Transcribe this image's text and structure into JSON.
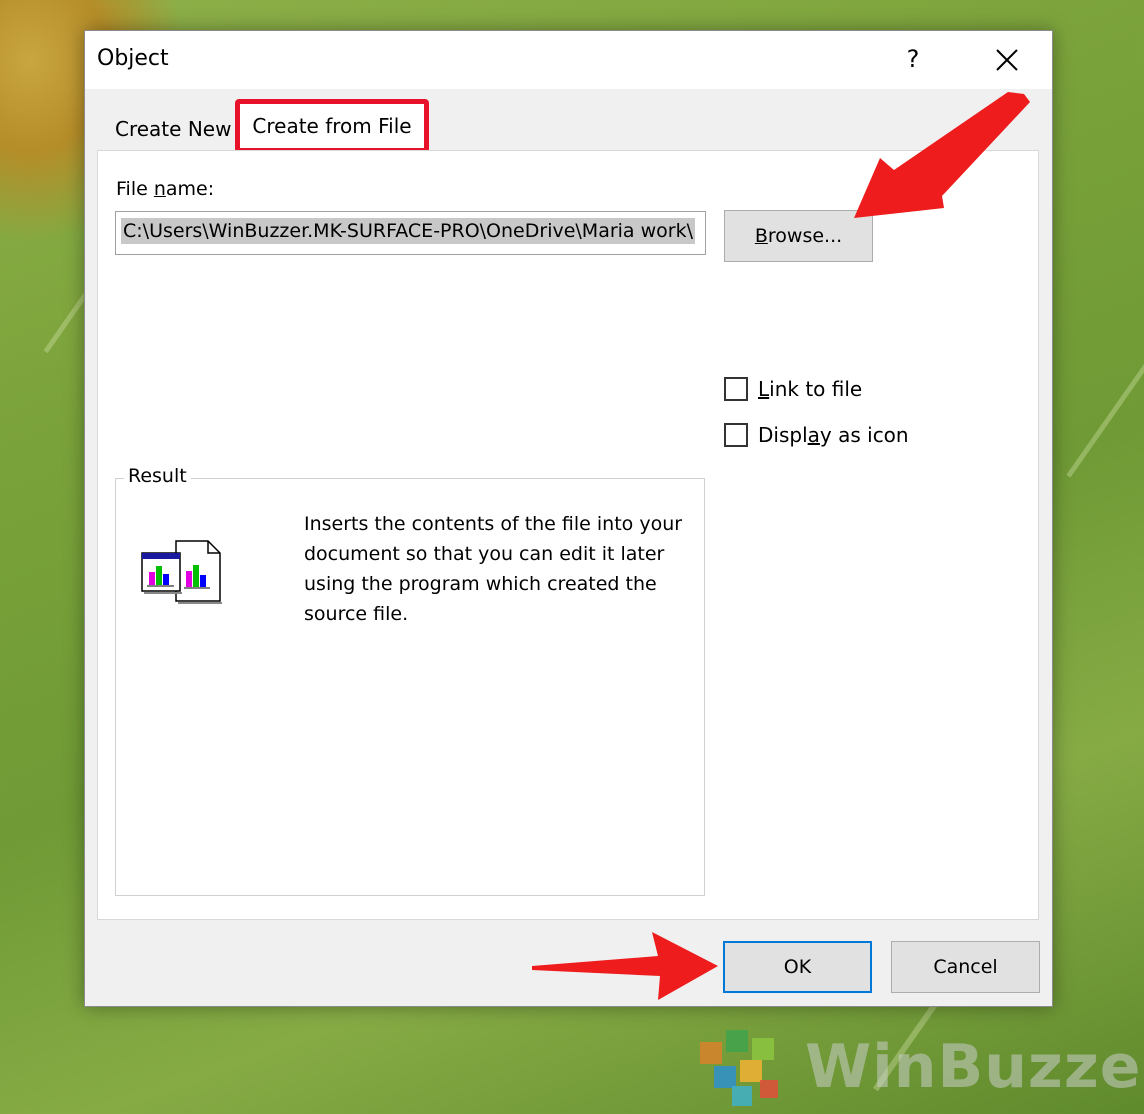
{
  "dialog": {
    "title": "Object",
    "help_glyph": "?",
    "close_icon": "close-icon"
  },
  "tabs": [
    {
      "label": "Create New",
      "selected": false
    },
    {
      "label": "Create from File",
      "selected": true,
      "highlight_color": "#e8132a"
    }
  ],
  "file": {
    "label_prefix": "File ",
    "label_mnemonic": "n",
    "label_suffix": "ame:",
    "value": "C:\\Users\\WinBuzzer.MK-SURFACE-PRO\\OneDrive\\Maria work\\"
  },
  "browse": {
    "mnemonic": "B",
    "rest": "rowse..."
  },
  "options": {
    "link_prefix": "",
    "link_mnemonic": "L",
    "link_suffix": "ink to file",
    "link_checked": false,
    "display_prefix": "Displ",
    "display_mnemonic": "a",
    "display_suffix": "y as icon",
    "display_checked": false
  },
  "result": {
    "title": "Result",
    "description": "Inserts the contents of the file into your document so that you can edit it later using the program which created the source file.",
    "icon": "embedded-document-icon"
  },
  "buttons": {
    "ok": "OK",
    "cancel": "Cancel"
  },
  "annotations": {
    "arrow_color": "#ee1c1c"
  },
  "watermark": {
    "text": "WinBuzzer",
    "logo": "winbuzzer-cube-logo"
  }
}
